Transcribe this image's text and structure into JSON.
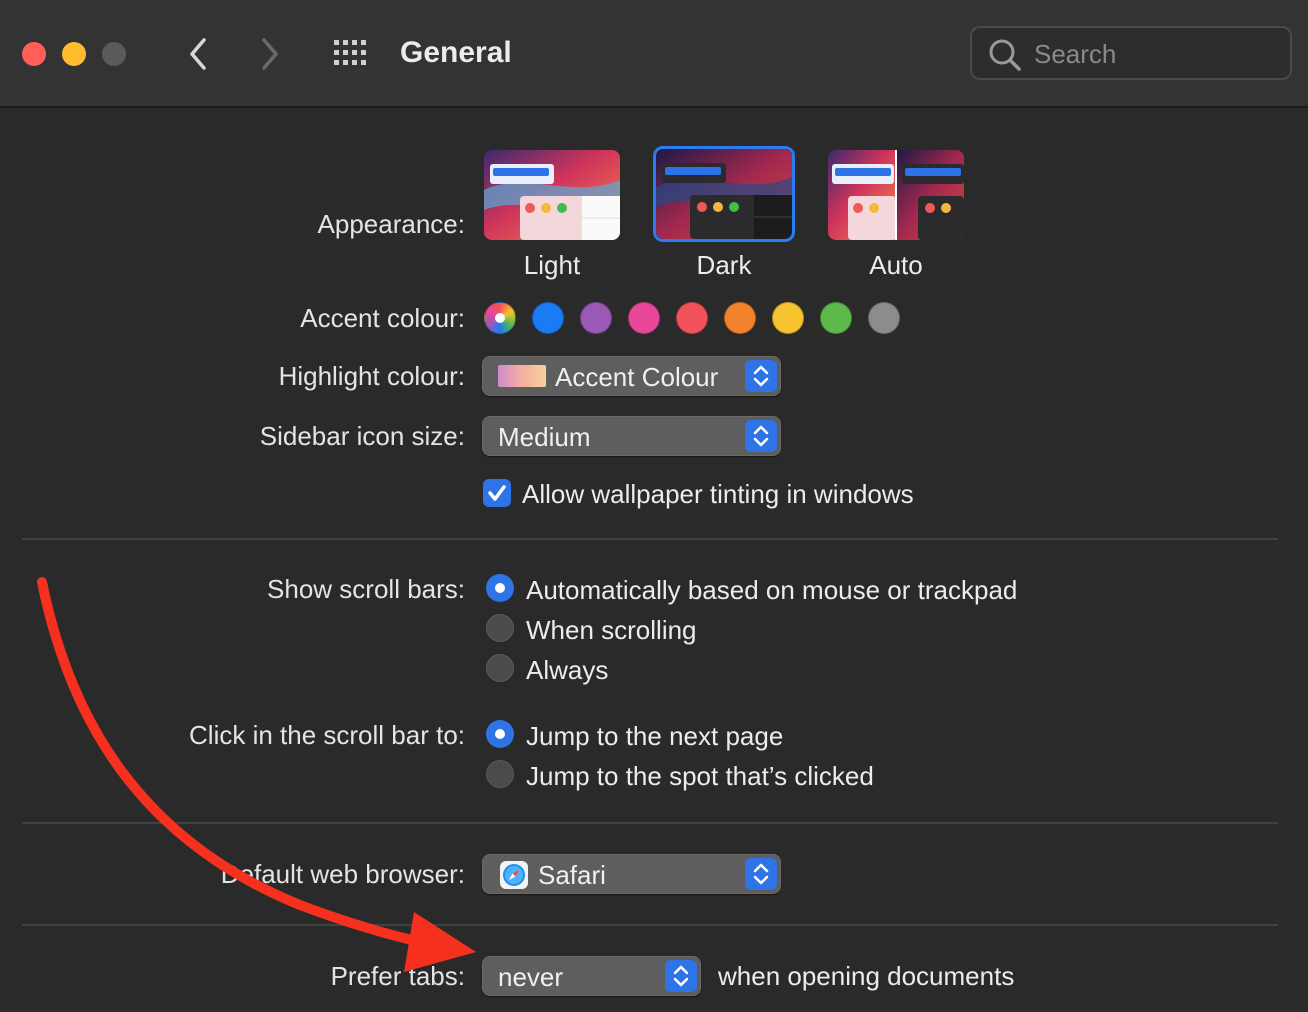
{
  "window": {
    "title": "General",
    "search_placeholder": "Search"
  },
  "toolbar_icons": [
    "close-icon",
    "minimize-icon",
    "zoom-icon",
    "chevron-left-icon",
    "chevron-right-icon",
    "grid-icon",
    "search-icon"
  ],
  "appearance": {
    "label": "Appearance:",
    "options": [
      {
        "label": "Light",
        "selected": false
      },
      {
        "label": "Dark",
        "selected": true
      },
      {
        "label": "Auto",
        "selected": false
      }
    ]
  },
  "accent": {
    "label": "Accent colour:",
    "colors": [
      "multicolor",
      "#1a7cf5",
      "#9b59b6",
      "#e8479a",
      "#f2525a",
      "#f2832c",
      "#f7c32e",
      "#5cb94a",
      "#8c8c8c"
    ],
    "selected_index": 0
  },
  "highlight": {
    "label": "Highlight colour:",
    "value": "Accent Colour"
  },
  "sidebar_icon_size": {
    "label": "Sidebar icon size:",
    "value": "Medium"
  },
  "wallpaper_tinting": {
    "label": "Allow wallpaper tinting in windows",
    "checked": true
  },
  "scroll_bars": {
    "label": "Show scroll bars:",
    "options": [
      {
        "label": "Automatically based on mouse or trackpad",
        "selected": true
      },
      {
        "label": "When scrolling",
        "selected": false
      },
      {
        "label": "Always",
        "selected": false
      }
    ]
  },
  "click_scroll_bar": {
    "label": "Click in the scroll bar to:",
    "options": [
      {
        "label": "Jump to the next page",
        "selected": true
      },
      {
        "label": "Jump to the spot that’s clicked",
        "selected": false
      }
    ]
  },
  "default_browser": {
    "label": "Default web browser:",
    "value": "Safari",
    "icon": "safari-icon"
  },
  "prefer_tabs": {
    "label": "Prefer tabs:",
    "value": "never",
    "suffix": "when opening documents"
  },
  "annotation": {
    "type": "arrow",
    "color": "#f5301e"
  }
}
